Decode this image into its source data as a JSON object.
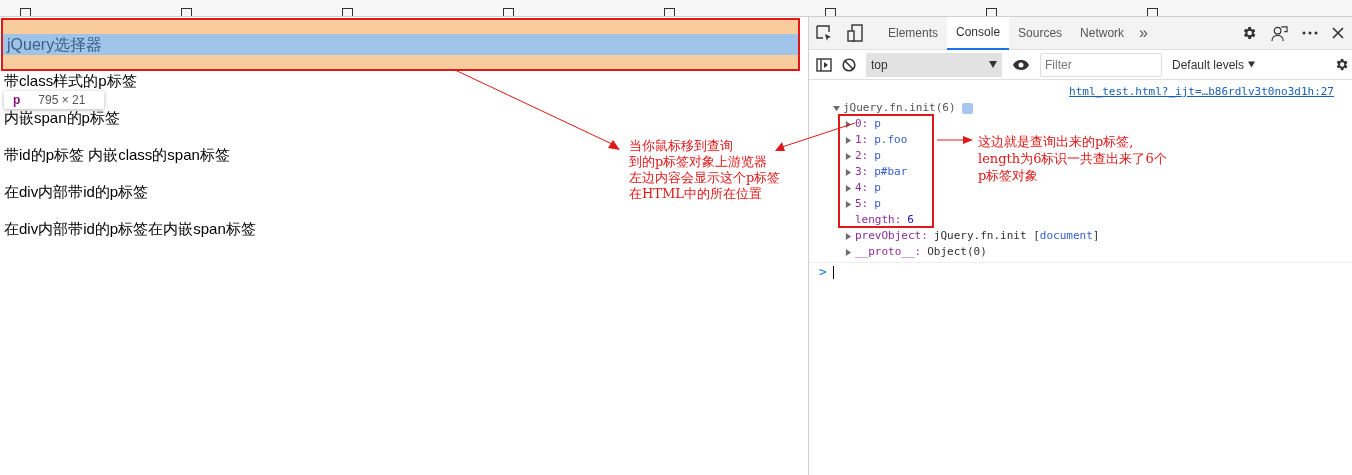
{
  "page": {
    "paragraphs": [
      {
        "text": "jQuery选择器",
        "highlighted": true
      },
      {
        "text": "带class样式的p标签",
        "highlighted": false
      },
      {
        "text": "内嵌span的p标签",
        "highlighted": false
      },
      {
        "text": "带id的p标签 内嵌class的span标签",
        "highlighted": false
      },
      {
        "text": "在div内部带id的p标签",
        "highlighted": false
      },
      {
        "text": "在div内部带id的p标签在内嵌span标签",
        "highlighted": false
      }
    ],
    "tooltip": {
      "tag": "p",
      "size": "795 × 21"
    }
  },
  "devtools": {
    "tabs": [
      {
        "label": "Elements",
        "selected": false
      },
      {
        "label": "Console",
        "selected": true
      },
      {
        "label": "Sources",
        "selected": false
      },
      {
        "label": "Network",
        "selected": false
      }
    ],
    "more": "»",
    "context": "top",
    "filter": {
      "placeholder": "Filter"
    },
    "levels": "Default levels",
    "console": {
      "source_link": "html_test.html?_ijt=…b86rdlv3t0no3d1h:27",
      "object": {
        "label": "jQuery.fn.init(6)",
        "expanded": true,
        "entries": [
          {
            "kind": "element",
            "key": "0:",
            "value": "p"
          },
          {
            "kind": "element",
            "key": "1:",
            "value": "p.foo"
          },
          {
            "kind": "element",
            "key": "2:",
            "value": "p"
          },
          {
            "kind": "element",
            "key": "3:",
            "value": "p#bar"
          },
          {
            "kind": "element",
            "key": "4:",
            "value": "p"
          },
          {
            "kind": "element",
            "key": "5:",
            "value": "p"
          },
          {
            "kind": "number",
            "key": "length:",
            "value": "6"
          },
          {
            "kind": "object",
            "key": "prevObject:",
            "value": "jQuery.fn.init [",
            "detail": "document",
            "suffix": "]"
          },
          {
            "kind": "object",
            "key": "__proto__:",
            "value": "Object(0)"
          }
        ]
      },
      "prompt": ">"
    }
  },
  "annotations": [
    {
      "lines": [
        "当你鼠标移到查询",
        "到的p标签对象上游览器",
        "左边内容会显示这个p标签",
        "在HTML中的所在位置"
      ]
    },
    {
      "lines": [
        "这边就是查询出来的p标签,",
        "length为6标识一共查出来了6个",
        "p标签对象"
      ]
    }
  ]
}
